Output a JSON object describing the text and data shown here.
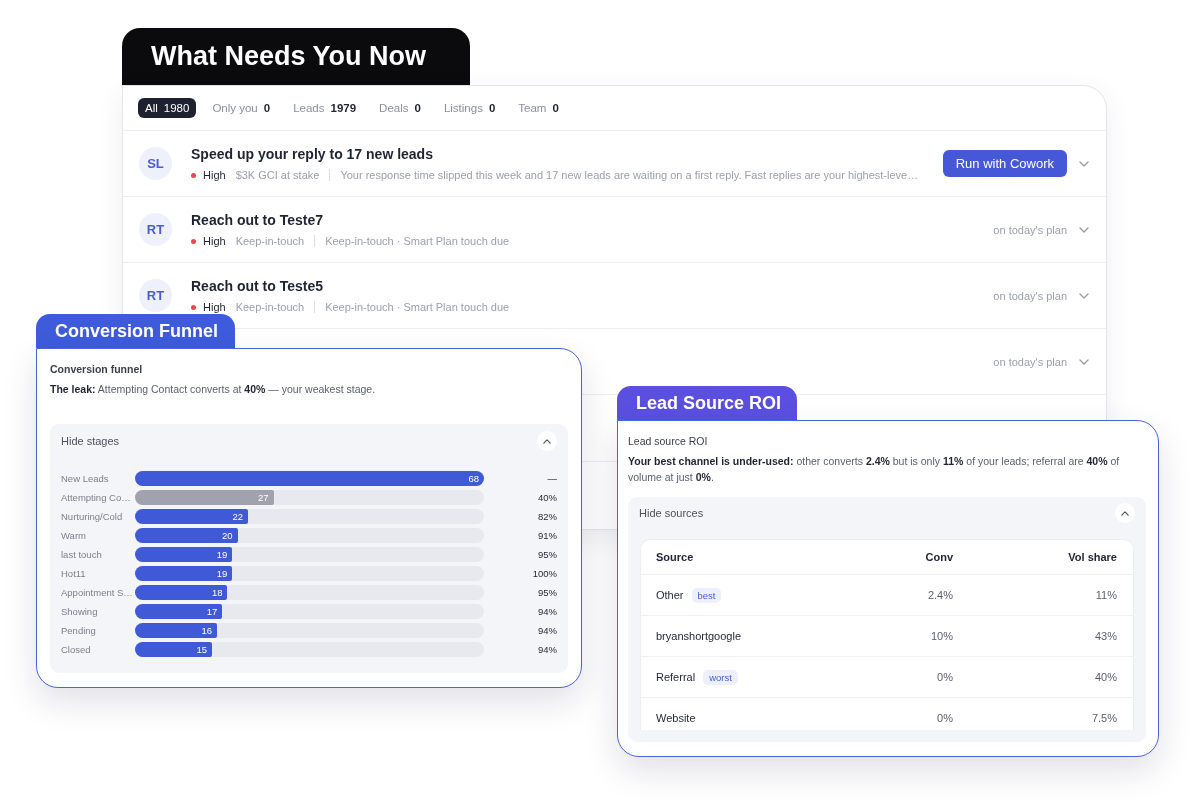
{
  "header": {
    "title": "What Needs You Now"
  },
  "filters": [
    {
      "label": "All",
      "count": "1980",
      "selected": true
    },
    {
      "label": "Only you",
      "count": "0",
      "selected": false
    },
    {
      "label": "Leads",
      "count": "1979",
      "selected": false
    },
    {
      "label": "Deals",
      "count": "0",
      "selected": false
    },
    {
      "label": "Listings",
      "count": "0",
      "selected": false
    },
    {
      "label": "Team",
      "count": "0",
      "selected": false
    }
  ],
  "tasks": [
    {
      "avatar": "SL",
      "title": "Speed up your reply to 17 new leads",
      "priority": {
        "label": "High",
        "kind": "high"
      },
      "tag": "$3K GCI at stake",
      "detail": "Your response time slipped this week and 17 new leads are waiting on a first reply. Fast replies are your highest-leve…",
      "action": {
        "kind": "button",
        "label": "Run with Cowork"
      },
      "expanded": false
    },
    {
      "avatar": "RT",
      "title": "Reach out to Teste7",
      "priority": {
        "label": "High",
        "kind": "high"
      },
      "tag": "Keep-in-touch",
      "detail": "Keep-in-touch · Smart Plan touch due",
      "action": {
        "kind": "note",
        "label": "on today's plan"
      },
      "expanded": false
    },
    {
      "avatar": "RT",
      "title": "Reach out to Teste5",
      "priority": {
        "label": "High",
        "kind": "high"
      },
      "tag": "Keep-in-touch",
      "detail": "Keep-in-touch · Smart Plan touch due",
      "action": {
        "kind": "note",
        "label": "on today's plan"
      },
      "expanded": false
    },
    {
      "action": {
        "kind": "note",
        "label": "on today's plan"
      },
      "expanded": false
    }
  ],
  "funnel": {
    "tab": "Conversion Funnel",
    "title": "Conversion funnel",
    "summary": "**The leak:** Attempting Contact converts at **40%** — your weakest stage.",
    "toggle": {
      "label": "Hide stages",
      "expanded": true
    },
    "stages": [
      {
        "label": "New Leads",
        "count": "68",
        "level": 1,
        "rate": "—",
        "weakest": false
      },
      {
        "label": "Attempting Co…",
        "count": "27",
        "level": 0.397,
        "rate": "40%",
        "weakest": true
      },
      {
        "label": "Nurturing/Cold",
        "count": "22",
        "level": 0.324,
        "rate": "82%",
        "weakest": false
      },
      {
        "label": "Warm",
        "count": "20",
        "level": 0.294,
        "rate": "91%",
        "weakest": false
      },
      {
        "label": "last touch",
        "count": "19",
        "level": 0.279,
        "rate": "95%",
        "weakest": false
      },
      {
        "label": "Hot11",
        "count": "19",
        "level": 0.279,
        "rate": "100%",
        "weakest": false
      },
      {
        "label": "Appointment S…",
        "count": "18",
        "level": 0.265,
        "rate": "95%",
        "weakest": false
      },
      {
        "label": "Showing",
        "count": "17",
        "level": 0.25,
        "rate": "94%",
        "weakest": false
      },
      {
        "label": "Pending",
        "count": "16",
        "level": 0.235,
        "rate": "94%",
        "weakest": false
      },
      {
        "label": "Closed",
        "count": "15",
        "level": 0.221,
        "rate": "94%",
        "weakest": false
      }
    ]
  },
  "lead_sources": {
    "tab": "Lead Source ROI",
    "title": "Lead source ROI",
    "summary": "**Your best channel is under-used:** other converts **2.4%** but is only **11%** of your leads; referral are **40%** of volume at just **0%**.",
    "toggle": {
      "label": "Hide sources",
      "expanded": true
    },
    "table": {
      "columns": [
        "Source",
        "Conv",
        "Vol share"
      ],
      "rows": [
        {
          "source": "Other",
          "badge": "best",
          "conv": "2.4%",
          "share": "11%"
        },
        {
          "source": "bryanshortgoogle",
          "conv": "10%",
          "share": "43%"
        },
        {
          "source": "Referral",
          "badge": "worst",
          "conv": "0%",
          "share": "40%"
        },
        {
          "source": "Website",
          "conv": "0%",
          "share": "7.5%"
        }
      ]
    }
  }
}
